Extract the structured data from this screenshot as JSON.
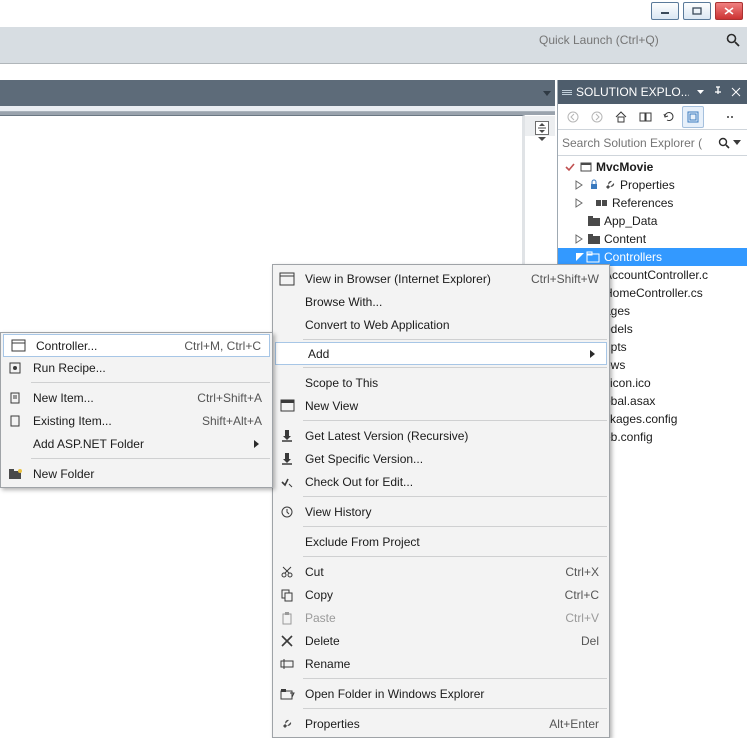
{
  "quicklaunch": {
    "placeholder": "Quick Launch (Ctrl+Q)"
  },
  "solution_explorer": {
    "title": "SOLUTION EXPLO...",
    "search_placeholder": "Search Solution Explorer (",
    "tree": {
      "root": "MvcMovie",
      "properties": "Properties",
      "references": "References",
      "appdata": "App_Data",
      "content": "Content",
      "controllers": "Controllers",
      "accountctrl": "AccountController.c",
      "homectrl": "HomeController.cs",
      "ages": "ages",
      "odels": "odels",
      "ripts": "ripts",
      "ews": "ews",
      "vicon": "vicon.ico",
      "obal": "obal.asax",
      "ckages": "ckages.config",
      "ebconfig": "eb.config"
    }
  },
  "context_menu": {
    "view_browser": "View in Browser (Internet Explorer)",
    "view_browser_sc": "Ctrl+Shift+W",
    "browse_with": "Browse With...",
    "convert": "Convert to Web Application",
    "add": "Add",
    "scope": "Scope to This",
    "new_view": "New View",
    "get_latest": "Get Latest Version (Recursive)",
    "get_specific": "Get Specific Version...",
    "check_out": "Check Out for Edit...",
    "view_history": "View History",
    "exclude": "Exclude From Project",
    "cut": "Cut",
    "cut_sc": "Ctrl+X",
    "copy": "Copy",
    "copy_sc": "Ctrl+C",
    "paste": "Paste",
    "paste_sc": "Ctrl+V",
    "delete": "Delete",
    "delete_sc": "Del",
    "rename": "Rename",
    "open_folder": "Open Folder in Windows Explorer",
    "properties": "Properties",
    "properties_sc": "Alt+Enter"
  },
  "add_menu": {
    "controller": "Controller...",
    "controller_sc": "Ctrl+M, Ctrl+C",
    "run_recipe": "Run Recipe...",
    "new_item": "New Item...",
    "new_item_sc": "Ctrl+Shift+A",
    "existing_item": "Existing Item...",
    "existing_item_sc": "Shift+Alt+A",
    "asp_folder": "Add ASP.NET Folder",
    "new_folder": "New Folder"
  }
}
